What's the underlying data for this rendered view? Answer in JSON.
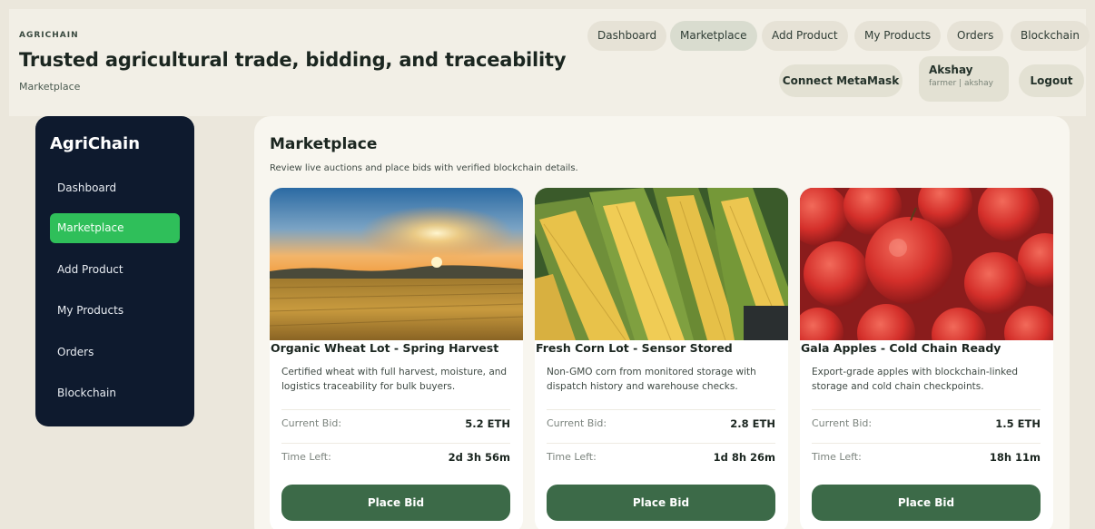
{
  "header": {
    "brand": "AGRICHAIN",
    "title": "Trusted agricultural trade, bidding, and traceability",
    "breadcrumb": "Marketplace",
    "nav": [
      "Dashboard",
      "Marketplace",
      "Add Product",
      "My Products",
      "Orders",
      "Blockchain"
    ],
    "active_nav": "Marketplace",
    "connect_label": "Connect MetaMask",
    "user_name": "Akshay",
    "user_role": "farmer | akshay",
    "logout_label": "Logout"
  },
  "sidebar": {
    "brand": "AgriChain",
    "items": [
      "Dashboard",
      "Marketplace",
      "Add Product",
      "My Products",
      "Orders",
      "Blockchain"
    ],
    "active_item": "Marketplace"
  },
  "main": {
    "title": "Marketplace",
    "subtitle": "Review live auctions and place bids with verified blockchain details.",
    "bid_label": "Current Bid:",
    "time_label": "Time Left:",
    "button_label": "Place Bid",
    "products": [
      {
        "title": "Organic Wheat Lot - Spring Harvest",
        "description": "Certified wheat with full harvest, moisture, and logistics traceability for bulk buyers.",
        "current_bid": "5.2 ETH",
        "time_left": "2d 3h 56m",
        "image": "wheat-field-sunset"
      },
      {
        "title": "Fresh Corn Lot - Sensor Stored",
        "description": "Non-GMO corn from monitored storage with dispatch history and warehouse checks.",
        "current_bid": "2.8 ETH",
        "time_left": "1d 8h 26m",
        "image": "corn-cobs"
      },
      {
        "title": "Gala Apples - Cold Chain Ready",
        "description": "Export-grade apples with blockchain-linked storage and cold chain checkpoints.",
        "current_bid": "1.5 ETH",
        "time_left": "18h 11m",
        "image": "red-apples"
      }
    ]
  },
  "colors": {
    "sidebar_bg": "#0e1a2e",
    "active_green": "#2fbf5a",
    "button_green": "#3c6a48",
    "page_bg": "#ebe7dc"
  }
}
